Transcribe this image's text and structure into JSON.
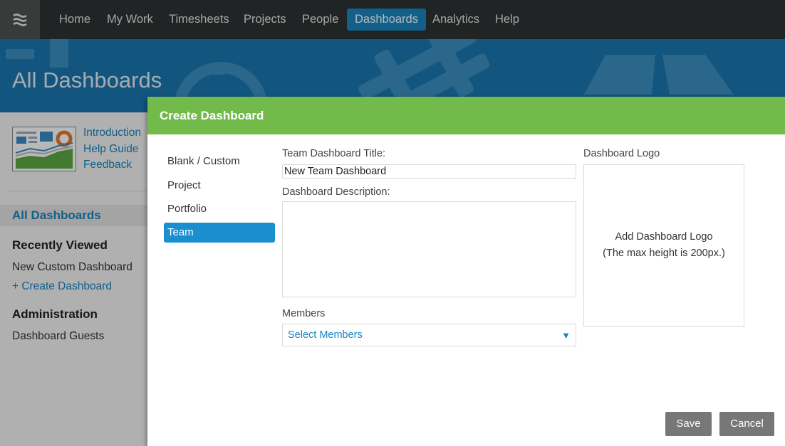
{
  "nav": {
    "logo_icon": "menu-waves-icon",
    "items": [
      "Home",
      "My Work",
      "Timesheets",
      "Projects",
      "People",
      "Dashboards",
      "Analytics",
      "Help"
    ],
    "active": "Dashboards"
  },
  "hero": {
    "title": "All Dashboards"
  },
  "sidebar": {
    "links": [
      "Introduction",
      "Help Guide",
      "Feedback"
    ],
    "active_item": "All Dashboards",
    "recently_viewed_heading": "Recently Viewed",
    "recent_item": "New Custom Dashboard",
    "create_link": "+ Create Dashboard",
    "admin_heading": "Administration",
    "admin_item": "Dashboard Guests"
  },
  "modal": {
    "title": "Create Dashboard",
    "types": [
      "Blank / Custom",
      "Project",
      "Portfolio",
      "Team"
    ],
    "selected_type": "Team",
    "title_label": "Team Dashboard Title:",
    "title_value": "New Team Dashboard",
    "description_label": "Dashboard Description:",
    "description_value": "",
    "members_label": "Members",
    "members_placeholder": "Select Members",
    "logo_label": "Dashboard Logo",
    "logo_add": "Add Dashboard Logo",
    "logo_hint": "(The max height is 200px.)",
    "save": "Save",
    "cancel": "Cancel"
  },
  "colors": {
    "nav_bg": "#2f3232",
    "nav_active": "#1a84c0",
    "hero_bg": "#1a78b0",
    "modal_header": "#72bb4b",
    "type_selected": "#1a8fd0",
    "button_bg": "#777777"
  }
}
